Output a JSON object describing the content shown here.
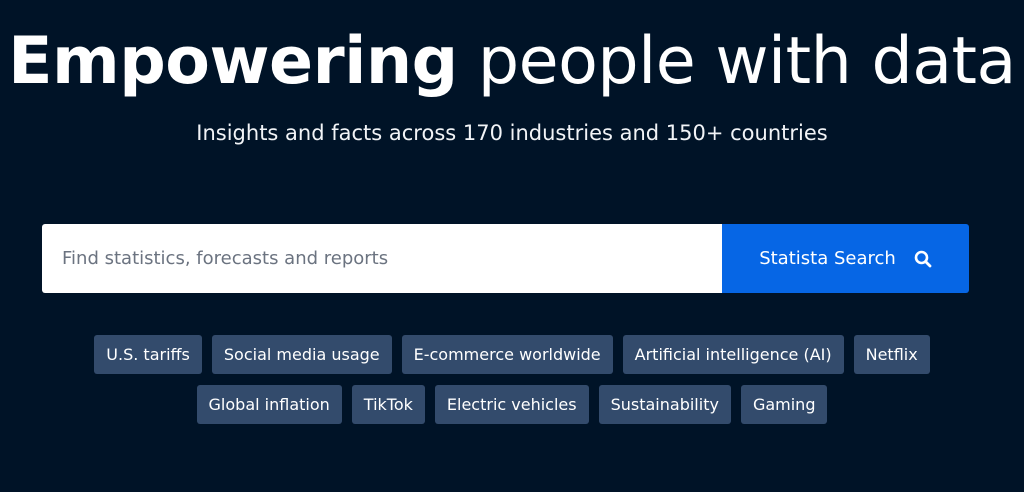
{
  "hero": {
    "headline_strong": "Empowering",
    "headline_light": "people with data",
    "subline": "Insights and facts across 170 industries and 150+ countries"
  },
  "search": {
    "placeholder": "Find statistics, forecasts and reports",
    "button_label": "Statista Search",
    "button_icon": "search-icon"
  },
  "tags": {
    "row1": [
      "U.S. tariffs",
      "Social media usage",
      "E-commerce worldwide",
      "Artificial intelligence (AI)",
      "Netflix"
    ],
    "row2": [
      "Global inflation",
      "TikTok",
      "Electric vehicles",
      "Sustainability",
      "Gaming"
    ]
  },
  "colors": {
    "background": "#001327",
    "search_button": "#0666e5",
    "tag_background": "#334b6c"
  }
}
